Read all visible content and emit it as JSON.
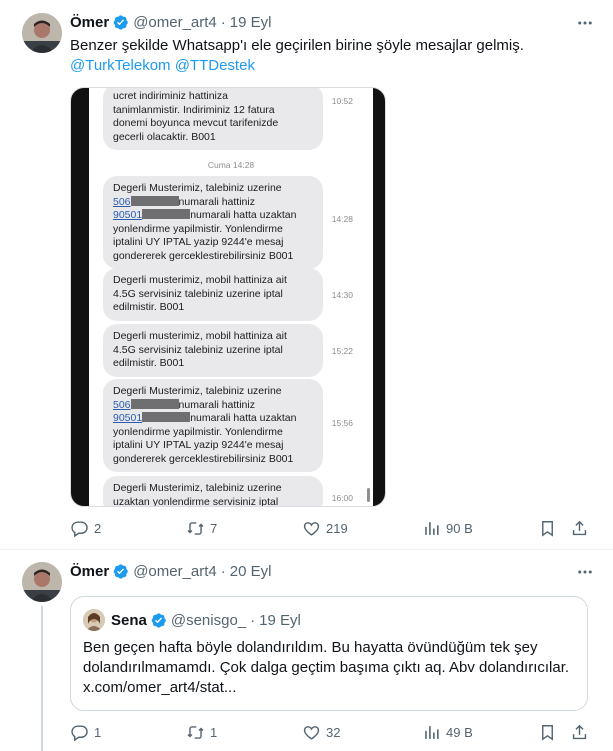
{
  "colors": {
    "accent": "#1d9bf0",
    "text": "#0f1419",
    "muted": "#536471",
    "border": "#cfd9de"
  },
  "tweet1": {
    "name": "Ömer",
    "handle": "@omer_art4",
    "separator": "·",
    "date": "19 Eyl",
    "text": "Benzer şekilde Whatsapp'ı ele geçirilen birine şöyle mesajlar gelmiş.",
    "mentions": [
      "@TurkTelekom",
      "@TTDestek"
    ],
    "sms": {
      "day_label": "Cuma 14:28",
      "messages": [
        {
          "lines": [
            "ucret indiriminiz hattiniza",
            "tanimlanmistir. Indiriminiz 12 fatura",
            "donemi boyunca mevcut tarifenizde",
            "gecerli olacaktir. B001"
          ],
          "time": "10:52"
        },
        {
          "line1": "Degerli Musterimiz, talebiniz uzerine",
          "prefix1": "506",
          "after1": "numarali hattiniz",
          "prefix2": "90501",
          "after2": "numarali hatta uzaktan",
          "lines": [
            "yonlendirme yapilmistir. Yonlendirme",
            "iptalini UY IPTAL yazip 9244'e mesaj",
            "gondererek gerceklestirebilirsiniz B001"
          ],
          "time": "14:28"
        },
        {
          "lines": [
            "Degerli musterimiz, mobil hattiniza ait",
            "4.5G servisiniz talebiniz uzerine iptal",
            "edilmistir. B001"
          ],
          "time": "14:30"
        },
        {
          "lines": [
            "Degerli musterimiz, mobil hattiniza ait",
            "4.5G servisiniz talebiniz uzerine iptal",
            "edilmistir. B001"
          ],
          "time": "15:22"
        },
        {
          "line1": "Degerli Musterimiz, talebiniz uzerine",
          "prefix1": "506",
          "after1": "numarali hattiniz",
          "prefix2": "90501",
          "after2": "numarali hatta uzaktan",
          "lines": [
            "yonlendirme yapilmistir. Yonlendirme",
            "iptalini UY IPTAL yazip 9244'e mesaj",
            "gondererek gerceklestirebilirsiniz B001"
          ],
          "time": "15:56"
        },
        {
          "lines": [
            "Degerli Musterimiz, talebiniz uzerine",
            "uzaktan yonlendirme servisiniz iptal"
          ],
          "time": "16:00"
        }
      ]
    },
    "actions": {
      "replies": "2",
      "reposts": "7",
      "likes": "219",
      "views": "90 B"
    }
  },
  "tweet2": {
    "name": "Ömer",
    "handle": "@omer_art4",
    "separator": "·",
    "date": "20 Eyl",
    "quote": {
      "name": "Sena",
      "handle": "@senisgo_",
      "separator": "·",
      "date": "19 Eyl",
      "text": "Ben geçen hafta böyle dolandırıldım. Bu hayatta övündüğüm tek şey dolandırılmamamdı. Çok dalga geçtim başıma çıktı aq. Abv dolandırıcılar. x.com/omer_art4/stat..."
    },
    "actions": {
      "replies": "1",
      "reposts": "1",
      "likes": "32",
      "views": "49 B"
    }
  },
  "icons": {
    "verified": "verified-badge-icon",
    "more": "more-horizontal-icon",
    "reply": "reply-icon",
    "repost": "repost-icon",
    "like": "heart-icon",
    "views": "views-icon",
    "bookmark": "bookmark-icon",
    "share": "share-icon"
  }
}
